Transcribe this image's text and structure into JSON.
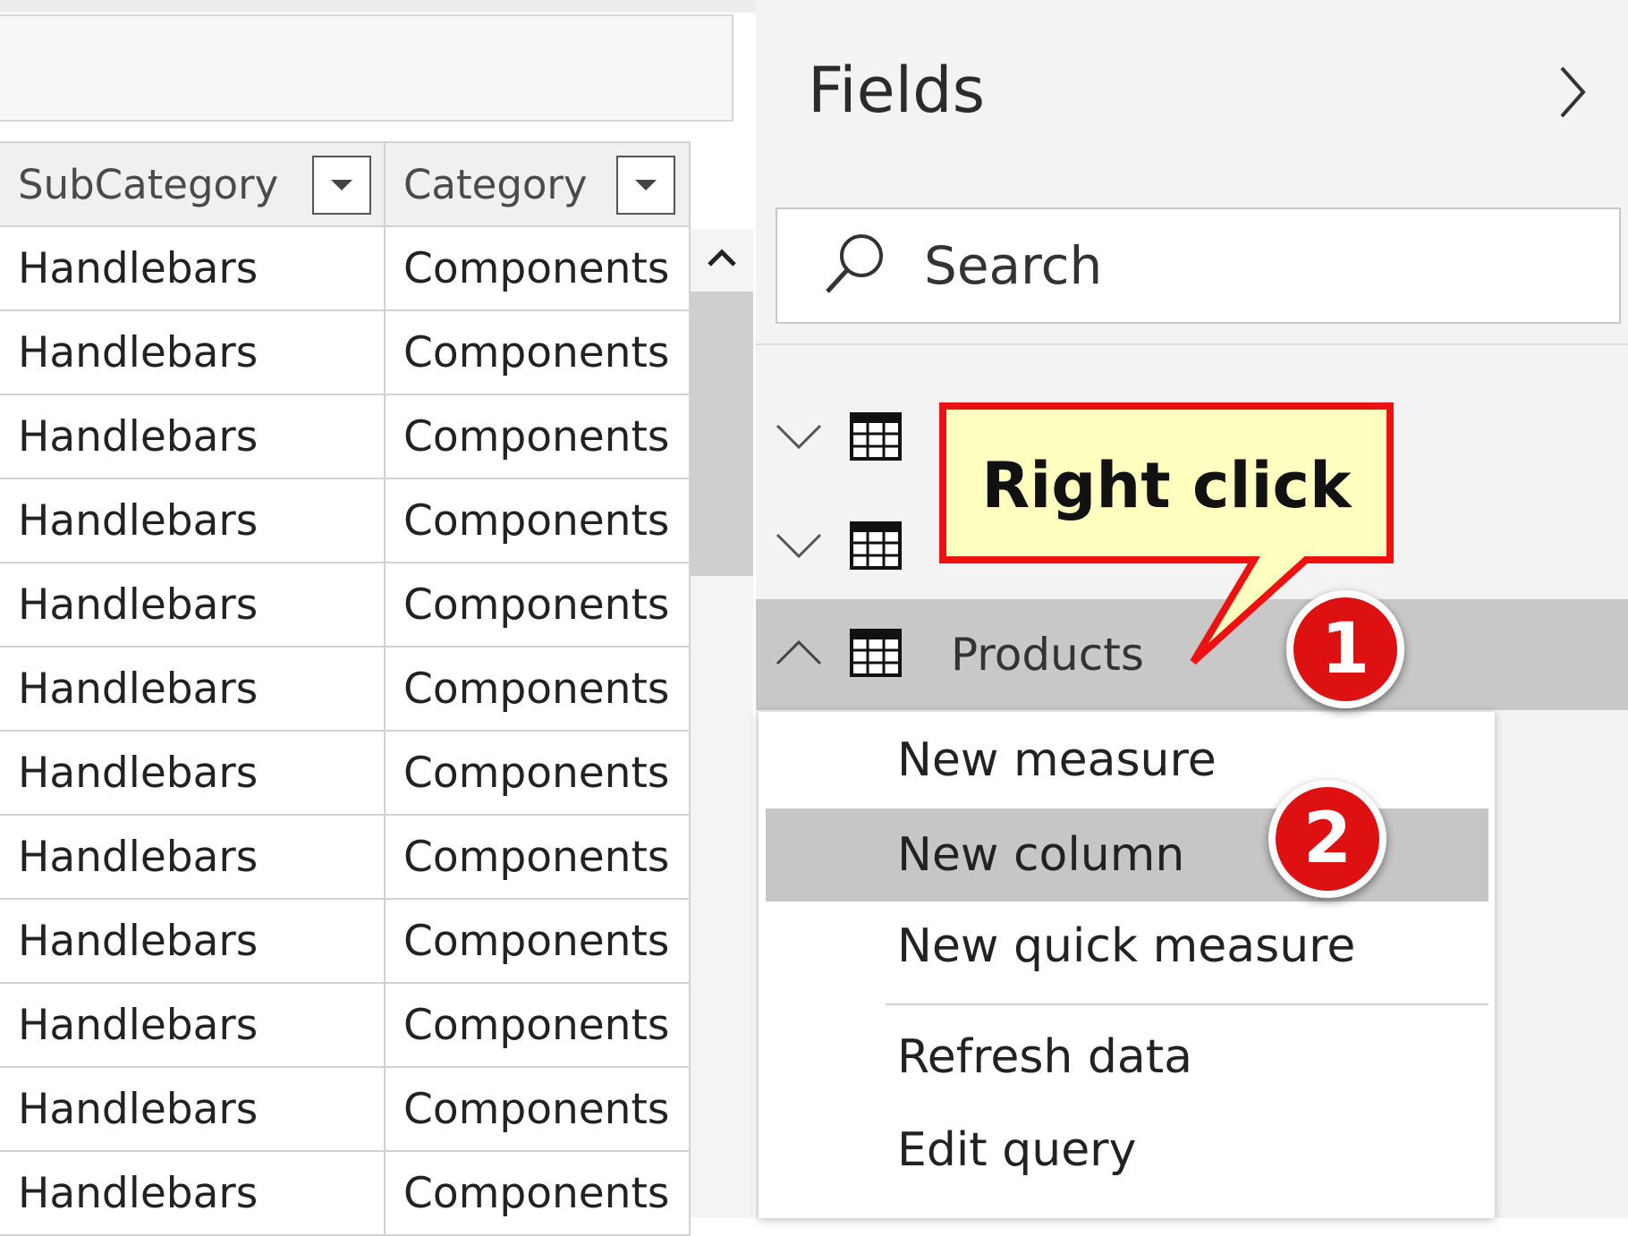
{
  "grid": {
    "columns": [
      {
        "label": "SubCategory"
      },
      {
        "label": "Category"
      }
    ],
    "rows": [
      [
        "Handlebars",
        "Components"
      ],
      [
        "Handlebars",
        "Components"
      ],
      [
        "Handlebars",
        "Components"
      ],
      [
        "Handlebars",
        "Components"
      ],
      [
        "Handlebars",
        "Components"
      ],
      [
        "Handlebars",
        "Components"
      ],
      [
        "Handlebars",
        "Components"
      ],
      [
        "Handlebars",
        "Components"
      ],
      [
        "Handlebars",
        "Components"
      ],
      [
        "Handlebars",
        "Components"
      ],
      [
        "Handlebars",
        "Components"
      ],
      [
        "Handlebars",
        "Components"
      ]
    ]
  },
  "fields_pane": {
    "title": "Fields",
    "search_placeholder": "Search",
    "tables": [
      {
        "label": ""
      },
      {
        "label": ""
      },
      {
        "label": "Products",
        "expanded": true
      }
    ]
  },
  "context_menu": {
    "items": {
      "new_measure": "New measure",
      "new_column": "New column",
      "new_quick_measure": "New quick measure",
      "refresh_data": "Refresh data",
      "edit_query": "Edit query"
    }
  },
  "annotations": {
    "callout": "Right click",
    "step1": "1",
    "step2": "2"
  },
  "colors": {
    "badge_red": "#dd1111",
    "callout_fill": "#ffffc0",
    "callout_border": "#ee1111",
    "highlight_gray": "#c6c6c6"
  }
}
